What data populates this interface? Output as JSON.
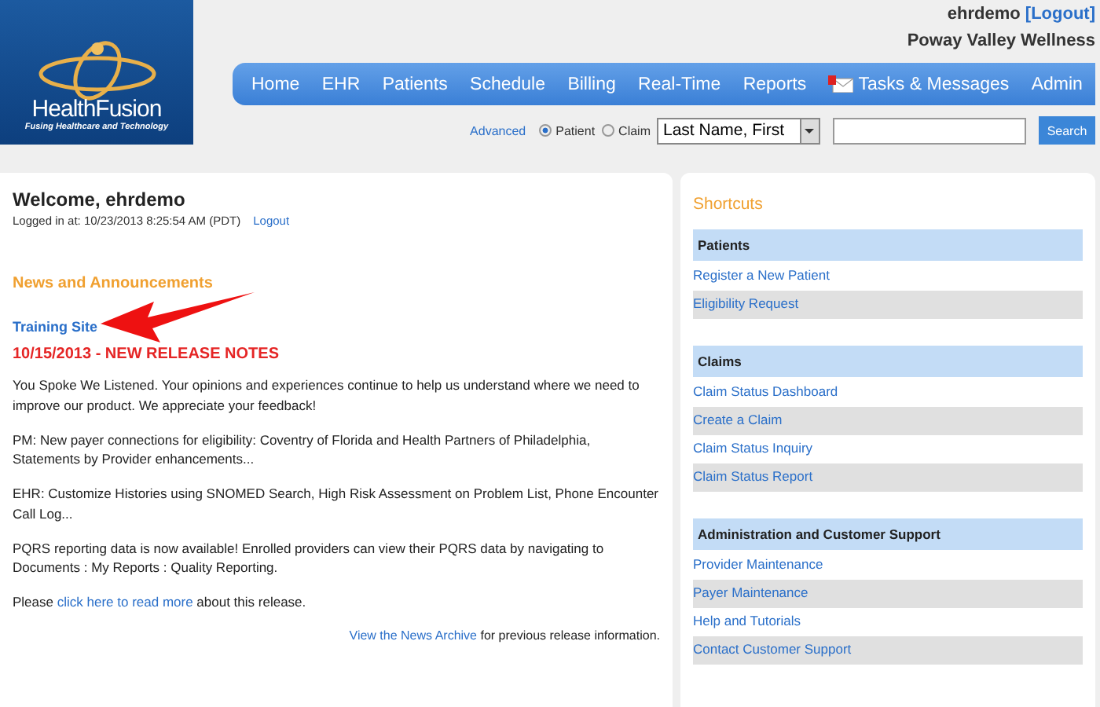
{
  "logo": {
    "name": "HealthFusion",
    "tagline": "Fusing Healthcare and Technology"
  },
  "user": {
    "name": "ehrdemo",
    "logout": "[Logout]",
    "practice": "Poway Valley Wellness"
  },
  "nav": [
    {
      "label": "Home",
      "alert": false
    },
    {
      "label": "EHR",
      "alert": false
    },
    {
      "label": "Patients",
      "alert": false
    },
    {
      "label": "Schedule",
      "alert": false
    },
    {
      "label": "Billing",
      "alert": false
    },
    {
      "label": "Real-Time",
      "alert": false
    },
    {
      "label": "Reports",
      "alert": false
    },
    {
      "label": "Tasks & Messages",
      "alert": true
    },
    {
      "label": "Admin",
      "alert": false
    }
  ],
  "search": {
    "advanced": "Advanced",
    "options": [
      {
        "label": "Patient",
        "selected": true
      },
      {
        "label": "Claim",
        "selected": false
      }
    ],
    "field_type": "Last Name, First",
    "button": "Search"
  },
  "welcome": {
    "title": "Welcome, ehrdemo",
    "logged_in": "Logged in at: 10/23/2013 8:25:54 AM (PDT)",
    "logout": "Logout"
  },
  "news": {
    "heading": "News and Announcements",
    "training_link": "Training Site",
    "release_title": "10/15/2013  -  NEW RELEASE NOTES",
    "paragraphs": [
      [
        {
          "text": "You Spoke We Listened. Your opinions and experiences continue to help us understand where we need to improve our product. We appreciate your feedback!",
          "link": false
        }
      ],
      [
        {
          "text": "PM: New payer connections for eligibility: Coventry of Florida and Health Partners of Philadelphia, Statements by Provider enhancements...",
          "link": false
        }
      ],
      [
        {
          "text": "EHR: Customize Histories using SNOMED Search, High Risk Assessment on Problem List, Phone Encounter Call Log...",
          "link": false
        }
      ],
      [
        {
          "text": "PQRS reporting data is now available! Enrolled providers can view their PQRS data by navigating to Documents : My Reports : Quality Reporting.",
          "link": false
        }
      ],
      [
        {
          "text": "Please ",
          "link": false
        },
        {
          "text": "click here to read more",
          "link": true
        },
        {
          "text": " about this release.",
          "link": false
        }
      ]
    ],
    "archive": [
      {
        "text": "View the News Archive",
        "link": true
      },
      {
        "text": " for previous release information.",
        "link": false
      }
    ]
  },
  "shortcuts": {
    "title": "Shortcuts",
    "groups": [
      {
        "heading": "Patients",
        "links": [
          "Register a New Patient",
          "Eligibility Request"
        ]
      },
      {
        "heading": "Claims",
        "links": [
          "Claim Status Dashboard",
          "Create a Claim",
          "Claim Status Inquiry",
          "Claim Status Report"
        ]
      },
      {
        "heading": "Administration and Customer Support",
        "links": [
          "Provider Maintenance",
          "Payer Maintenance",
          "Help and Tutorials",
          "Contact Customer Support"
        ]
      }
    ]
  }
}
